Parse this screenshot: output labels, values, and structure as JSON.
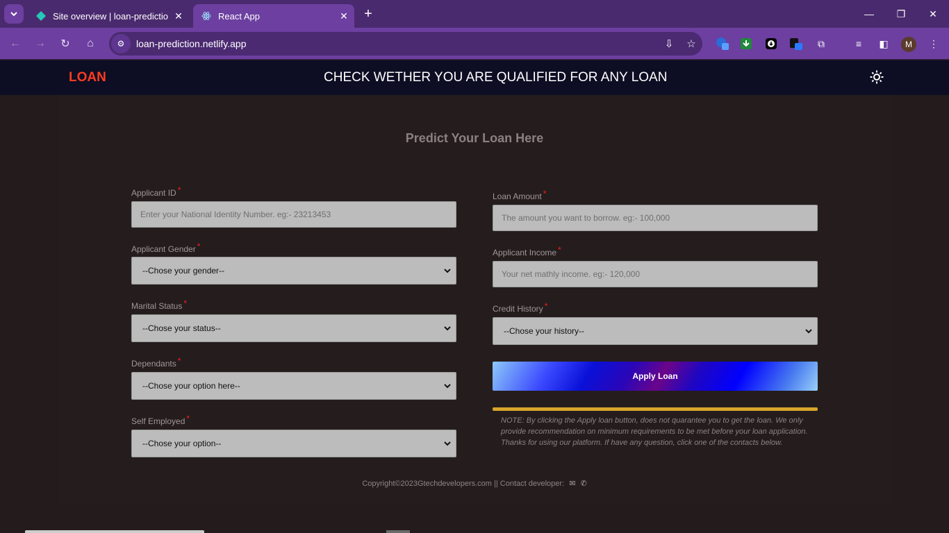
{
  "browser": {
    "tabs": [
      {
        "title": "Site overview | loan-prediction |",
        "favicon": "netlify-diamond-icon",
        "active": false
      },
      {
        "title": "React App",
        "favicon": "react-atom-icon",
        "active": true
      }
    ],
    "url": "loan-prediction.netlify.app",
    "profile_initial": "M",
    "colors": {
      "tabbar": "#4a2a6e",
      "toolbar": "#6c3fa0",
      "omnibox": "#4b2a71"
    }
  },
  "header": {
    "logo": "LOAN",
    "headline": "CHECK WETHER YOU ARE QUALIFIED FOR ANY LOAN",
    "theme_icon": "sun-icon"
  },
  "form": {
    "title": "Predict Your Loan Here",
    "required_mark": "*",
    "applicant_id": {
      "label": "Applicant ID",
      "placeholder": "Enter your National Identity Number. eg:- 23213453"
    },
    "gender": {
      "label": "Applicant Gender",
      "selected": "--Chose your gender--"
    },
    "marital": {
      "label": "Marital Status",
      "selected": "--Chose your status--"
    },
    "dependants": {
      "label": "Dependants",
      "selected": "--Chose your option here--"
    },
    "self_employed": {
      "label": "Self Employed",
      "selected": "--Chose your option--"
    },
    "loan_amount": {
      "label": "Loan Amount",
      "placeholder": "The amount you want to borrow. eg:- 100,000"
    },
    "income": {
      "label": "Applicant Income",
      "placeholder": "Your net mathly income. eg:- 120,000"
    },
    "credit_history": {
      "label": "Credit History",
      "selected": "--Chose your history--"
    },
    "apply_label": "Apply Loan",
    "note": "NOTE: By clicking the Apply loan button, does not quarantee you to get the loan. We only provide recommendation on minimum requirements to be met before your loan application. Thanks for using our platform. If have any question, click one of the contacts below."
  },
  "footer": {
    "text": "Copyright©2023Gtechdevelopers.com || Contact developer:",
    "icons": [
      "envelope-icon",
      "phone-icon"
    ]
  },
  "colors": {
    "accent_logo": "#ff3b1f",
    "required": "#ff1a1a",
    "note_bar": "#d9a62a",
    "page_bg": "#241c1c",
    "header_bg": "#0d0d24"
  }
}
